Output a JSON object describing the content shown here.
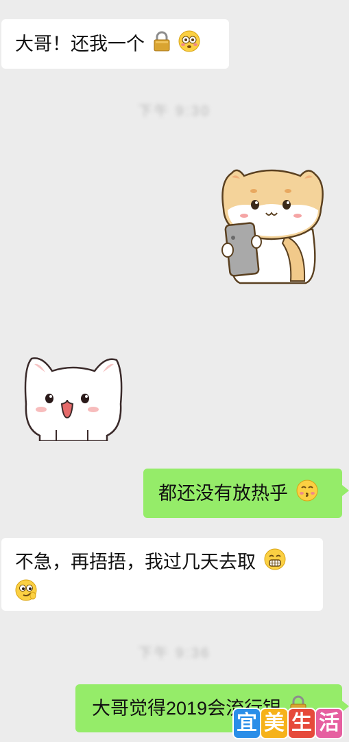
{
  "messages": [
    {
      "text": "大哥！还我一个",
      "emojis": [
        "lock-icon",
        "flushed-face-icon"
      ]
    },
    {
      "timestamp": "下午 9:30"
    },
    {
      "sticker": "shiba-dog-holding-phone-sticker"
    },
    {
      "sticker": "white-cat-sticker"
    },
    {
      "text": "都还没有放热乎",
      "emojis": [
        "kiss-face-icon"
      ]
    },
    {
      "text_line1": "不急，再捂捂，我过几天去取",
      "text_line2": "",
      "emojis": [
        "grimace-face-icon",
        "smirk-face-icon"
      ]
    },
    {
      "timestamp": "下午 9:36"
    },
    {
      "text": "大哥觉得2019会流行银",
      "emojis": [
        "lock-icon"
      ]
    }
  ],
  "watermark": {
    "chars": [
      "宜",
      "美",
      "生",
      "活"
    ],
    "colors": [
      "#2a8ee8",
      "#f6b21a",
      "#e64a3b",
      "#e65fa0"
    ]
  },
  "colors": {
    "background": "#ececec",
    "left_bubble": "#ffffff",
    "right_bubble": "#95ec69"
  }
}
